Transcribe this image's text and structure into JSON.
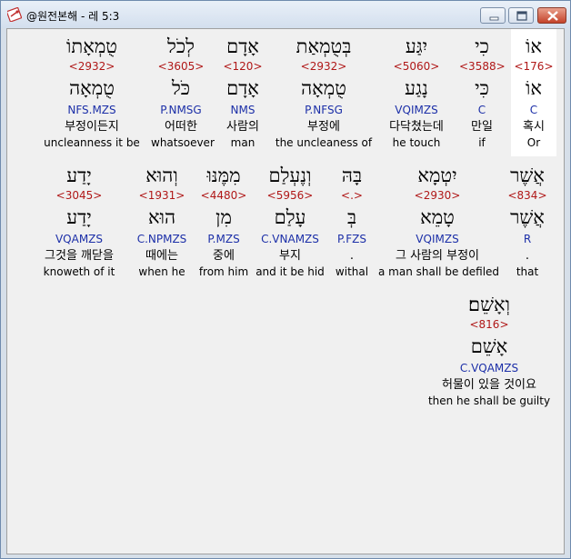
{
  "window": {
    "title": "@원전본해 - 레 5:3"
  },
  "row1": [
    {
      "hebrew": "אוֹ",
      "strong": "<176>",
      "lemma": "אוֹ",
      "morph": "C",
      "korean": "혹시",
      "english": "Or"
    },
    {
      "hebrew": "כִי",
      "strong": "<3588>",
      "lemma": "כִּי",
      "morph": "C",
      "korean": "만일",
      "english": "if"
    },
    {
      "hebrew": "יִגַּע",
      "strong": "<5060>",
      "lemma": "נָגַע",
      "morph": "VQIMZS",
      "korean": "다닥쳤는데",
      "english": "he touch"
    },
    {
      "hebrew": "בְּטֻמְאַת",
      "strong": "<2932>",
      "lemma": "טֻמְאָה",
      "morph": "P.NFSG",
      "korean": "부정에",
      "english": "the uncleaness of"
    },
    {
      "hebrew": "אָדָם",
      "strong": "<120>",
      "lemma": "אָדָם",
      "morph": "NMS",
      "korean": "사람의",
      "english": "man"
    },
    {
      "hebrew": "לְכֹל",
      "strong": "<3605>",
      "lemma": "כֹּל",
      "morph": "P.NMSG",
      "korean": "어떠한",
      "english": "whatsoever"
    },
    {
      "hebrew": "טֻמְאָתוֹ",
      "strong": "<2932>",
      "lemma": "טֻמְאָה",
      "morph": "NFS.MZS",
      "korean": "부정이든지",
      "english": "uncleanness it be"
    }
  ],
  "row2": [
    {
      "hebrew": "אֲשֶׁר",
      "strong": "<834>",
      "lemma": "אֲשֶׁר",
      "morph": "R",
      "korean": ".",
      "english": "that"
    },
    {
      "hebrew": "יִטְמָא",
      "strong": "<2930>",
      "lemma": "טָמֵא",
      "morph": "VQIMZS",
      "korean": "그 사람의 부정이",
      "english": "a man shall be defiled"
    },
    {
      "hebrew": "בָּהּ",
      "strong": "<.>",
      "lemma": "בְּ",
      "morph": "P.FZS",
      "korean": ".",
      "english": "withal"
    },
    {
      "hebrew": "וְנֶעְלַם",
      "strong": "<5956>",
      "lemma": "עָלַם",
      "morph": "C.VNAMZS",
      "korean": "부지",
      "english": "and it be hid"
    },
    {
      "hebrew": "מִמֶּנּוּ",
      "strong": "<4480>",
      "lemma": "מִן",
      "morph": "P.MZS",
      "korean": "중에",
      "english": "from him"
    },
    {
      "hebrew": "וְהוּא",
      "strong": "<1931>",
      "lemma": "הוּא",
      "morph": "C.NPMZS",
      "korean": "때에는",
      "english": "when he"
    },
    {
      "hebrew": "יָדַע",
      "strong": "<3045>",
      "lemma": "יָדַע",
      "morph": "VQAMZS",
      "korean": "그것을 깨닫을",
      "english": "knoweth of it"
    }
  ],
  "row3": [
    {
      "hebrew": "וְאָשֵׁם׃",
      "strong": "<816>",
      "lemma": "אָשֵׁם",
      "morph": "C.VQAMZS",
      "korean": "허물이 있을 것이요",
      "english": "then he shall be guilty"
    }
  ]
}
